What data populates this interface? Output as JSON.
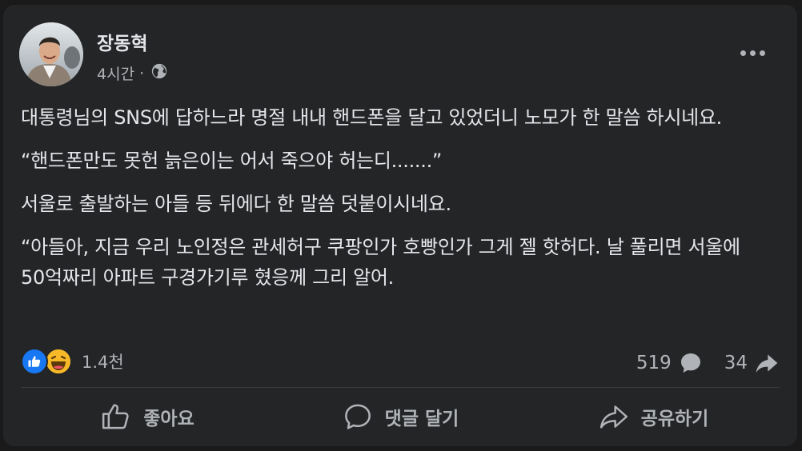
{
  "post": {
    "author": "장동혁",
    "time": "4시간",
    "separator": "·",
    "audience_icon": "globe-icon",
    "paragraphs": [
      "대통령님의 SNS에 답하느라 명절 내내 핸드폰을 달고 있었더니 노모가 한 말씀 하시네요.",
      "“핸드폰만도 못헌 늙은이는 어서 죽으야 허는디.......”",
      "서울로 출발하는 아들 등 뒤에다 한 말씀 덧붙이시네요.",
      "“아들아, 지금 우리 노인정은 관세허구 쿠팡인가 호빵인가 그게 젤 핫허다. 날 풀리면 서울에 50억짜리 아파트 구경가기루 혔응께 그리 알어."
    ]
  },
  "reactions": {
    "types": [
      "like",
      "haha"
    ],
    "count": "1.4천"
  },
  "stats": {
    "comments": "519",
    "shares": "34"
  },
  "actions": {
    "like": "좋아요",
    "comment": "댓글 달기",
    "share": "공유하기"
  },
  "colors": {
    "background": "#242526",
    "text_primary": "#e4e6eb",
    "text_secondary": "#b0b3b8",
    "like_blue": "#1877f2",
    "haha_yellow": "#f7b928"
  }
}
